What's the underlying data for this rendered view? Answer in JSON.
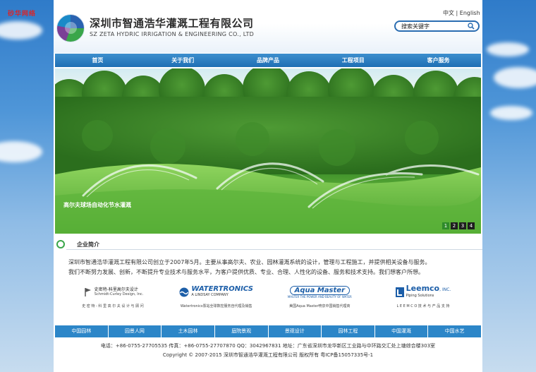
{
  "corner_logo": "砂华网络",
  "company": {
    "name_cn": "深圳市智通浩华灌溉工程有限公司",
    "name_en": "SZ ZETA HYDRIC IRRIGATION & ENGINEERING CO., LTD"
  },
  "language": {
    "zh": "中文",
    "separator": " | ",
    "en": "English"
  },
  "search": {
    "placeholder": "搜索关键字",
    "value": "搜索关键字"
  },
  "nav": {
    "items": [
      "首页",
      "关于我们",
      "品牌产品",
      "工程项目",
      "客户服务"
    ]
  },
  "banner": {
    "caption": "高尔夫球场自动化节水灌溉",
    "pages": [
      "1",
      "2",
      "3",
      "4"
    ],
    "active_page": "1"
  },
  "about": {
    "title": "企业简介",
    "text_line1": "深圳市智通浩华灌溉工程有限公司创立于2007年5月。主要从事高尔夫、农业、园林灌溉系统的设计，管理与工程施工，并提供相关设备与服务。",
    "text_line2": "我们不断努力发展、创新，不断提升专业技术与服务水平，为客户提供优质、专业、合理、人性化的设备、服务和技术支持。我们想客户所想。"
  },
  "partners": [
    {
      "logo_text": "史密特-科里高尔夫设计",
      "logo_sub": "Schmidt-Curley Design, Inc.",
      "caption": "史 密 特 - 科 里 高 尔 夫 设 计 与 顾 问"
    },
    {
      "logo_text": "WATERTRONICS",
      "logo_sub": "A LINDSAY COMPANY",
      "caption": "Watertronics泵站全球数控服务自代理及销售"
    },
    {
      "logo_text": "Aqua Master",
      "logo_sub": "MASTER THE POWER AND BEAUTY OF WATER",
      "caption": "美国Aqua Master喷泉中国销售代理商"
    },
    {
      "logo_text": "Leemco",
      "logo_suffix": ", INC.",
      "logo_sub": "Piping Solutions",
      "caption": "L E E M C O 技 术 与 产 品 支 持"
    }
  ],
  "footer_links": [
    "中国园林",
    "园景人网",
    "土木园林",
    "庭院景观",
    "景观设计",
    "园林工程",
    "中国灌溉",
    "中国水艺"
  ],
  "footer": {
    "contact": "电话：+86-0755-27705535   传真：+86-0755-27707870   QQ：3042967831   地址：广东省深圳市龙华新区工业路与中环路交汇处上塘综合楼303室",
    "copyright": "Copyright © 2007-2015 深圳市智通浩华灌溉工程有限公司 版权所有 粤ICP备15057335号-1"
  },
  "colors": {
    "nav_blue": "#1f6fb4",
    "accent_green": "#3aa64a",
    "corner_red": "#d8262a"
  }
}
